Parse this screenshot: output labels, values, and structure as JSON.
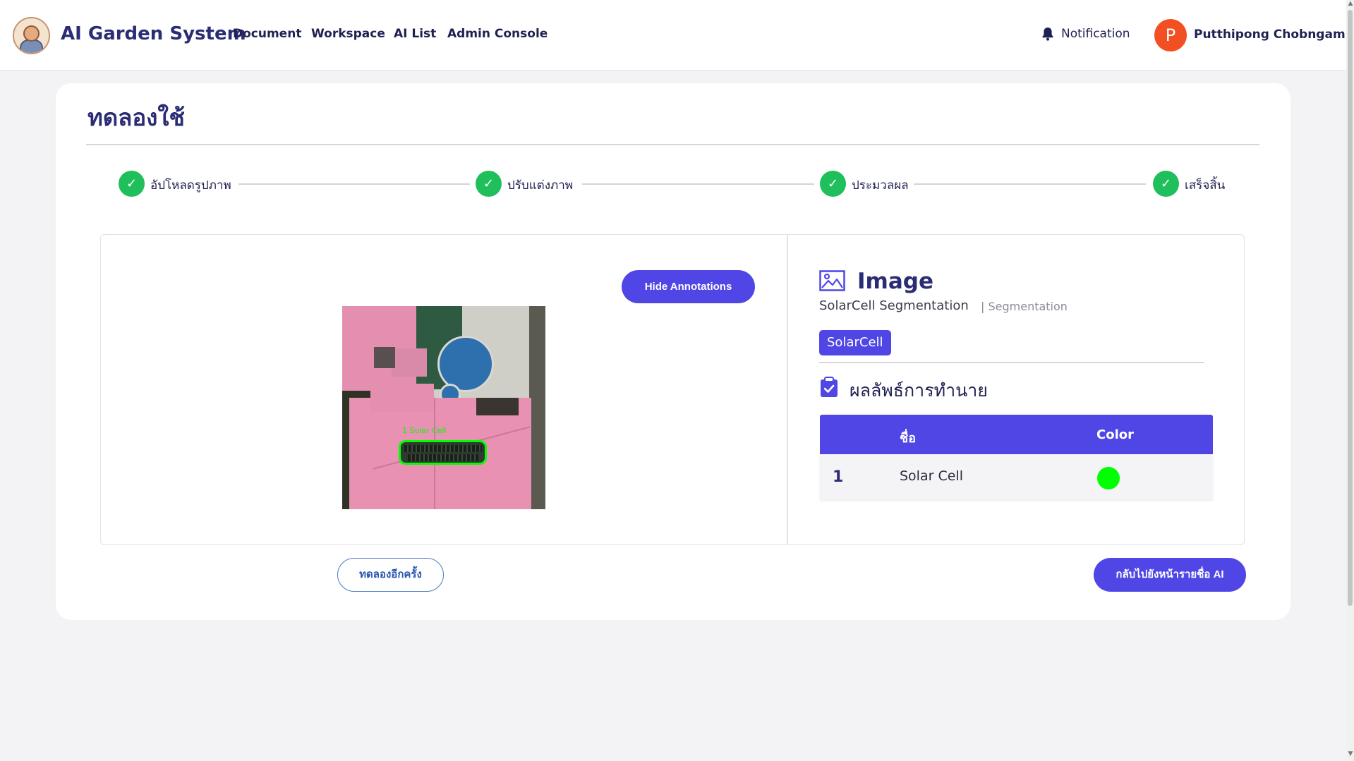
{
  "header": {
    "brand": "AI Garden System",
    "nav": [
      "Document",
      "Workspace",
      "AI List",
      "Admin Console"
    ],
    "notification_label": "Notification",
    "avatar_initial": "P",
    "user_name": "Putthipong Chobngam"
  },
  "page": {
    "title": "ทดลองใช้"
  },
  "stepper": {
    "steps": [
      {
        "label": "อัปโหลดรูปภาพ",
        "status": "done"
      },
      {
        "label": "ปรับแต่งภาพ",
        "status": "done"
      },
      {
        "label": "ประมวลผล",
        "status": "done"
      },
      {
        "label": "เสร็จสิ้น",
        "status": "done"
      }
    ],
    "check_glyph": "✓"
  },
  "preview": {
    "hide_annotations_label": "Hide Annotations",
    "annotation_label": "1 Solar Cell",
    "annotation_color": "#00ff00"
  },
  "info": {
    "section_title": "Image",
    "model_name": "SolarCell Segmentation",
    "model_type": "| Segmentation",
    "tag": "SolarCell",
    "result_title": "ผลลัพธ์การทำนาย",
    "table": {
      "headers": [
        "ชื่อ",
        "Color"
      ],
      "rows": [
        {
          "index": "1",
          "name": "Solar Cell",
          "color": "#00ff00"
        }
      ]
    }
  },
  "actions": {
    "retry_label": "ทดลองอีกครั้ง",
    "back_label": "กลับไปยังหน้ารายชื่อ AI"
  },
  "colors": {
    "primary": "#4f46e5",
    "success": "#1fbf5b",
    "heading": "#2a2c74",
    "avatar": "#f25022"
  },
  "icons": {
    "notification": "bell-icon",
    "image": "image-icon",
    "result": "clipboard-check-icon",
    "step": "check-icon"
  }
}
